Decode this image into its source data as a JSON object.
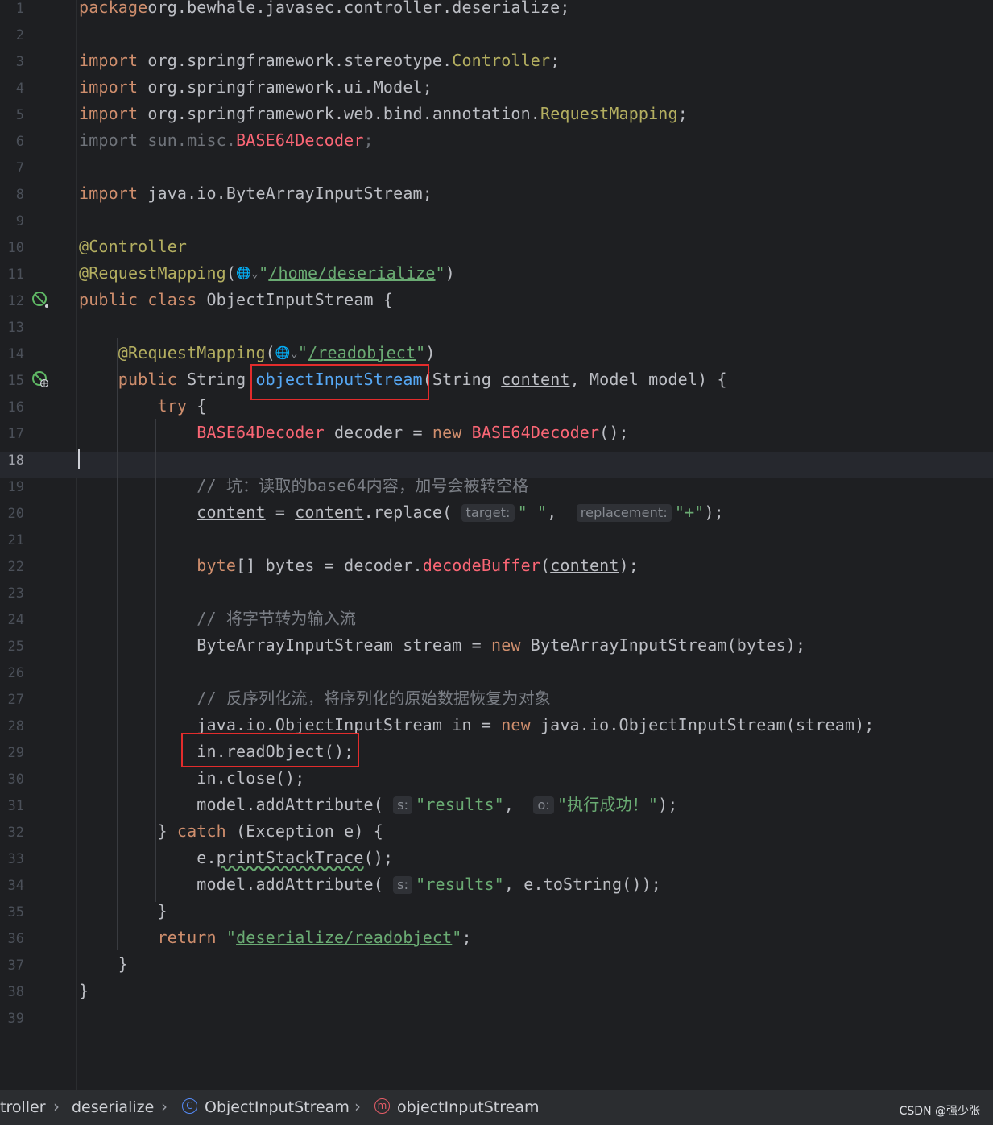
{
  "editor": {
    "lines": [
      {
        "n": "1",
        "segs": [
          [
            "kw",
            "package"
          ],
          [
            "",
            "org.bewhale.javasec.controller.deserialize;"
          ]
        ]
      },
      {
        "n": "2",
        "segs": []
      },
      {
        "n": "3",
        "segs": [
          [
            "kw",
            "import"
          ],
          [
            "",
            " org.springframework.stereotype."
          ],
          [
            "ann",
            "Controller"
          ],
          [
            "",
            ";"
          ]
        ]
      },
      {
        "n": "4",
        "segs": [
          [
            "kw",
            "import"
          ],
          [
            "",
            " org.springframework.ui.Model;"
          ]
        ]
      },
      {
        "n": "5",
        "segs": [
          [
            "kw",
            "import"
          ],
          [
            "",
            " org.springframework.web.bind.annotation."
          ],
          [
            "ann",
            "RequestMapping"
          ],
          [
            "",
            ";"
          ]
        ]
      },
      {
        "n": "6",
        "segs": [
          [
            "dim",
            "import sun.misc."
          ],
          [
            "warn",
            "BASE64Decoder"
          ],
          [
            "dim",
            ";"
          ]
        ]
      },
      {
        "n": "7",
        "segs": []
      },
      {
        "n": "8",
        "segs": [
          [
            "kw",
            "import"
          ],
          [
            "",
            " java.io.ByteArrayInputStream;"
          ]
        ]
      },
      {
        "n": "9",
        "segs": []
      },
      {
        "n": "10",
        "segs": [
          [
            "ann",
            "@Controller"
          ]
        ]
      },
      {
        "n": "11",
        "segs": [
          [
            "ann",
            "@RequestMapping"
          ],
          [
            "",
            "("
          ],
          [
            "globe",
            "🌐⌄"
          ],
          [
            "str",
            "\""
          ],
          [
            "url",
            "/home/deserialize"
          ],
          [
            "str",
            "\""
          ],
          [
            "",
            ")"
          ]
        ]
      },
      {
        "n": "12",
        "segs": [
          [
            "kw",
            "public class"
          ],
          [
            "",
            " ObjectInputStream {"
          ]
        ]
      },
      {
        "n": "13",
        "segs": []
      },
      {
        "n": "14",
        "segs": [
          [
            "",
            "    "
          ],
          [
            "ann",
            "@RequestMapping"
          ],
          [
            "",
            "("
          ],
          [
            "globe",
            "🌐⌄"
          ],
          [
            "str",
            "\""
          ],
          [
            "url",
            "/readobject"
          ],
          [
            "str",
            "\""
          ],
          [
            "",
            ")"
          ]
        ]
      },
      {
        "n": "15",
        "segs": [
          [
            "",
            "    "
          ],
          [
            "kw",
            "public"
          ],
          [
            "",
            " String "
          ],
          [
            "fn",
            "objectInputStream"
          ],
          [
            "",
            "(String "
          ],
          [
            "param",
            "content"
          ],
          [
            "",
            ", Model model) {"
          ]
        ]
      },
      {
        "n": "16",
        "segs": [
          [
            "",
            "        "
          ],
          [
            "kw",
            "try"
          ],
          [
            "",
            " {"
          ]
        ]
      },
      {
        "n": "17",
        "segs": [
          [
            "",
            "            "
          ],
          [
            "warn",
            "BASE64Decoder"
          ],
          [
            "",
            " decoder = "
          ],
          [
            "kw",
            "new"
          ],
          [
            "",
            " "
          ],
          [
            "warn",
            "BASE64Decoder"
          ],
          [
            "",
            "();"
          ]
        ]
      },
      {
        "n": "18",
        "segs": []
      },
      {
        "n": "19",
        "segs": [
          [
            "",
            "            "
          ],
          [
            "cmt",
            "// 坑：读取的base64内容，加号会被转空格"
          ]
        ]
      },
      {
        "n": "20",
        "segs": [
          [
            "",
            "            "
          ],
          [
            "param",
            "content"
          ],
          [
            "",
            " = "
          ],
          [
            "param",
            "content"
          ],
          [
            "",
            ".replace( "
          ],
          [
            "hint",
            "target:"
          ],
          [
            "str",
            "\" \""
          ],
          [
            "",
            ",  "
          ],
          [
            "hint",
            "replacement:"
          ],
          [
            "str",
            "\"+\""
          ],
          [
            "",
            ");"
          ]
        ]
      },
      {
        "n": "21",
        "segs": []
      },
      {
        "n": "22",
        "segs": [
          [
            "",
            "            "
          ],
          [
            "kw",
            "byte"
          ],
          [
            "",
            "[] bytes = decoder."
          ],
          [
            "warn",
            "decodeBuffer"
          ],
          [
            "",
            "("
          ],
          [
            "param",
            "content"
          ],
          [
            "",
            ");"
          ]
        ]
      },
      {
        "n": "23",
        "segs": []
      },
      {
        "n": "24",
        "segs": [
          [
            "",
            "            "
          ],
          [
            "cmt",
            "// 将字节转为输入流"
          ]
        ]
      },
      {
        "n": "25",
        "segs": [
          [
            "",
            "            ByteArrayInputStream stream = "
          ],
          [
            "kw",
            "new"
          ],
          [
            "",
            " ByteArrayInputStream(bytes);"
          ]
        ]
      },
      {
        "n": "26",
        "segs": []
      },
      {
        "n": "27",
        "segs": [
          [
            "",
            "            "
          ],
          [
            "cmt",
            "// 反序列化流，将序列化的原始数据恢复为对象"
          ]
        ]
      },
      {
        "n": "28",
        "segs": [
          [
            "",
            "            java.io.ObjectInputStream in = "
          ],
          [
            "kw",
            "new"
          ],
          [
            "",
            " java.io.ObjectInputStream(stream);"
          ]
        ]
      },
      {
        "n": "29",
        "segs": [
          [
            "",
            "            in.readObject();"
          ]
        ]
      },
      {
        "n": "30",
        "segs": [
          [
            "",
            "            in.close();"
          ]
        ]
      },
      {
        "n": "31",
        "segs": [
          [
            "",
            "            model.addAttribute( "
          ],
          [
            "hint",
            "s:"
          ],
          [
            "str",
            "\"results\""
          ],
          [
            "",
            ",  "
          ],
          [
            "hint",
            "o:"
          ],
          [
            "str",
            "\"执行成功！\""
          ],
          [
            "",
            ");"
          ]
        ]
      },
      {
        "n": "32",
        "segs": [
          [
            "",
            "        } "
          ],
          [
            "kw",
            "catch"
          ],
          [
            "",
            " (Exception e) {"
          ]
        ]
      },
      {
        "n": "33",
        "segs": [
          [
            "",
            "            e."
          ],
          [
            "squig",
            "printStackTrace"
          ],
          [
            "",
            "();"
          ]
        ]
      },
      {
        "n": "34",
        "segs": [
          [
            "",
            "            model.addAttribute( "
          ],
          [
            "hint",
            "s:"
          ],
          [
            "str",
            "\"results\""
          ],
          [
            "",
            ", e.toString());"
          ]
        ]
      },
      {
        "n": "35",
        "segs": [
          [
            "",
            "        }"
          ]
        ]
      },
      {
        "n": "36",
        "segs": [
          [
            "",
            "        "
          ],
          [
            "kw",
            "return"
          ],
          [
            "",
            " "
          ],
          [
            "str",
            "\""
          ],
          [
            "url",
            "deserialize/readobject"
          ],
          [
            "str",
            "\""
          ],
          [
            "",
            ";"
          ]
        ]
      },
      {
        "n": "37",
        "segs": [
          [
            "",
            "    }"
          ]
        ]
      },
      {
        "n": "38",
        "segs": [
          [
            "",
            "}"
          ]
        ]
      },
      {
        "n": "39",
        "segs": []
      }
    ],
    "current_line": "18",
    "gutter_icons": {
      "line12": "spring-bean-icon",
      "line15": "spring-endpoint-icon"
    }
  },
  "breadcrumb": {
    "items": [
      "troller",
      "deserialize",
      "ObjectInputStream",
      "objectInputStream"
    ],
    "separator": "›",
    "class_icon_letter": "C",
    "method_icon_letter": "m"
  },
  "watermark": "CSDN @强少张",
  "colors": {
    "background": "#1e1f22",
    "keyword": "#cf8e6d",
    "string": "#6aab73",
    "annotation": "#b3ae60",
    "method": "#56a8f5",
    "error": "#fa6675",
    "highlight_box": "#e32c2c"
  }
}
